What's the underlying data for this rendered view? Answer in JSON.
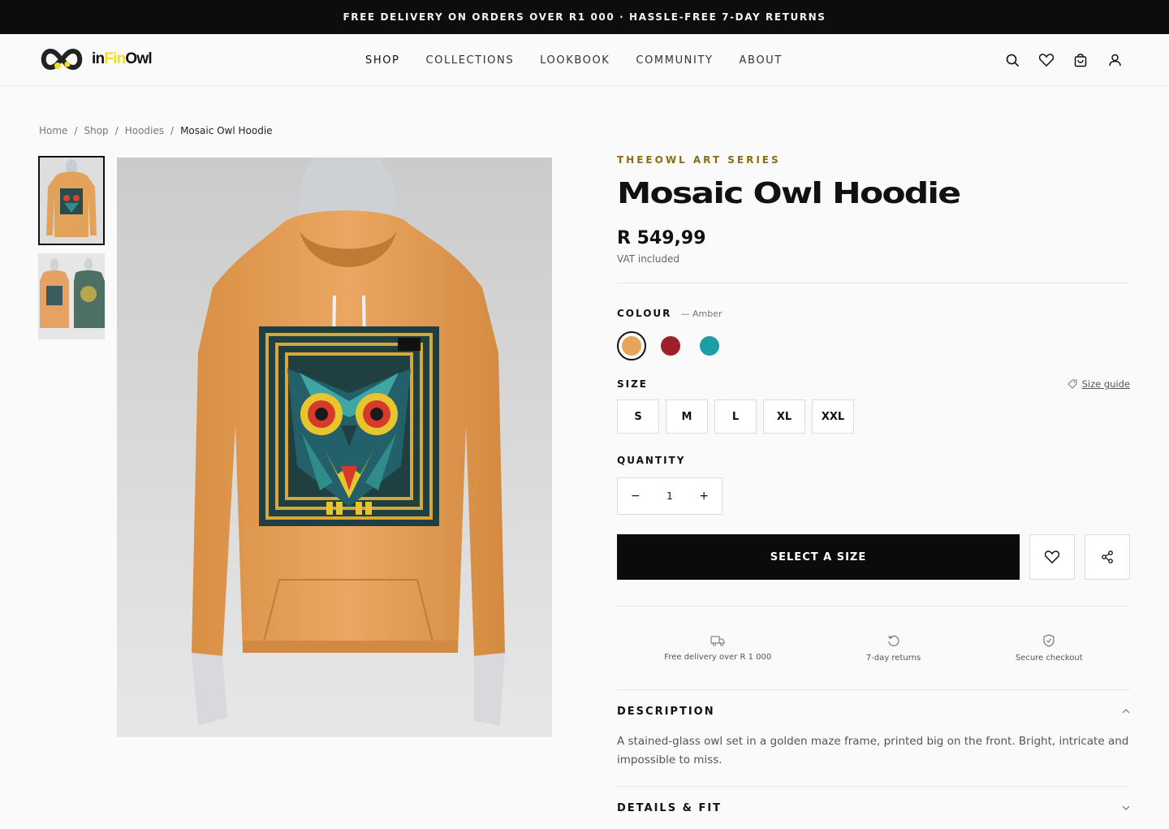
{
  "announcement": "FREE DELIVERY ON ORDERS OVER R1 000 · HASSLE-FREE 7-DAY RETURNS",
  "brand": {
    "logo_text_a": "in",
    "logo_text_b": "Fin",
    "logo_text_c": "Owl"
  },
  "nav": [
    {
      "label": "SHOP",
      "active": true
    },
    {
      "label": "COLLECTIONS"
    },
    {
      "label": "LOOKBOOK"
    },
    {
      "label": "COMMUNITY"
    },
    {
      "label": "ABOUT"
    }
  ],
  "header_icons": [
    "search-icon",
    "heart-icon",
    "bag-icon",
    "user-icon"
  ],
  "breadcrumb": [
    "Home",
    "Shop",
    "Hoodies",
    "Mosaic Owl Hoodie"
  ],
  "product": {
    "series": "THEEOWL ART SERIES",
    "title": "Mosaic Owl Hoodie",
    "price": "R 549,99",
    "vat": "VAT included",
    "colour_label": "COLOUR",
    "colour_selected": "— Amber",
    "colours": [
      {
        "name": "Amber",
        "hex": "#e8a55a"
      },
      {
        "name": "Crimson",
        "hex": "#9c1f2b"
      },
      {
        "name": "Teal",
        "hex": "#1b9ea4"
      }
    ],
    "size_label": "SIZE",
    "size_guide": "Size guide",
    "sizes": [
      "S",
      "M",
      "L",
      "XL",
      "XXL"
    ],
    "quantity_label": "QUANTITY",
    "quantity": "1",
    "cta": "SELECT A SIZE"
  },
  "features": [
    {
      "icon": "truck-icon",
      "label": "Free delivery over R 1 000"
    },
    {
      "icon": "return-icon",
      "label": "7-day returns"
    },
    {
      "icon": "shield-icon",
      "label": "Secure checkout"
    }
  ],
  "description": {
    "label": "DESCRIPTION",
    "text": "A stained-glass owl set in a golden maze frame, printed big on the front. Bright, intricate and impossible to miss."
  },
  "details": {
    "label": "DETAILS & FIT"
  }
}
